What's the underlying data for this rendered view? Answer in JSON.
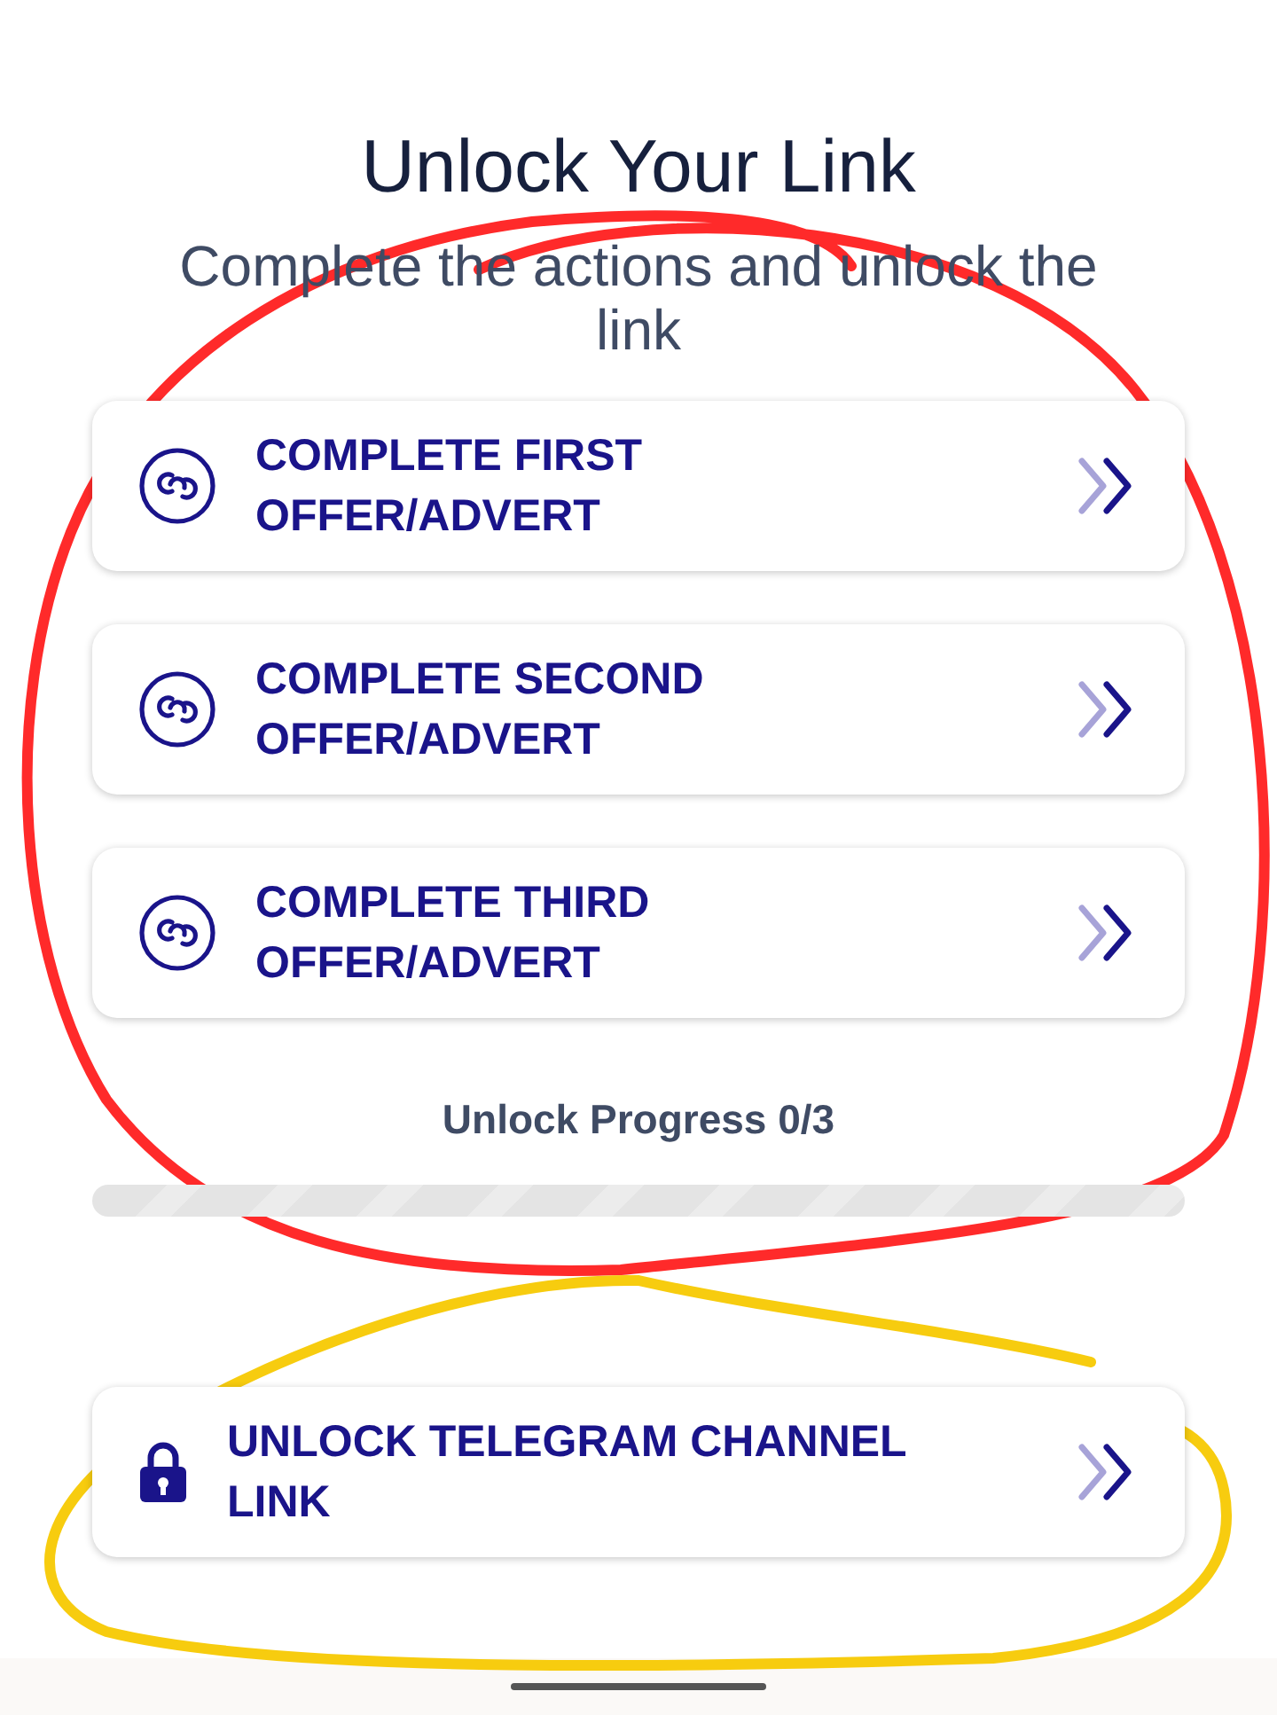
{
  "title": "Unlock Your Link",
  "subtitle": "Complete the actions and unlock the link",
  "actions": [
    {
      "kind": "offer",
      "label": "COMPLETE FIRST OFFER/ADVERT"
    },
    {
      "kind": "offer",
      "label": "COMPLETE SECOND OFFER/ADVERT"
    },
    {
      "kind": "offer",
      "label": "COMPLETE THIRD OFFER/ADVERT"
    }
  ],
  "progress": {
    "label": "Unlock Progress 0/3"
  },
  "final_action": {
    "kind": "lock",
    "label": "UNLOCK TELEGRAM CHANNEL LINK"
  }
}
